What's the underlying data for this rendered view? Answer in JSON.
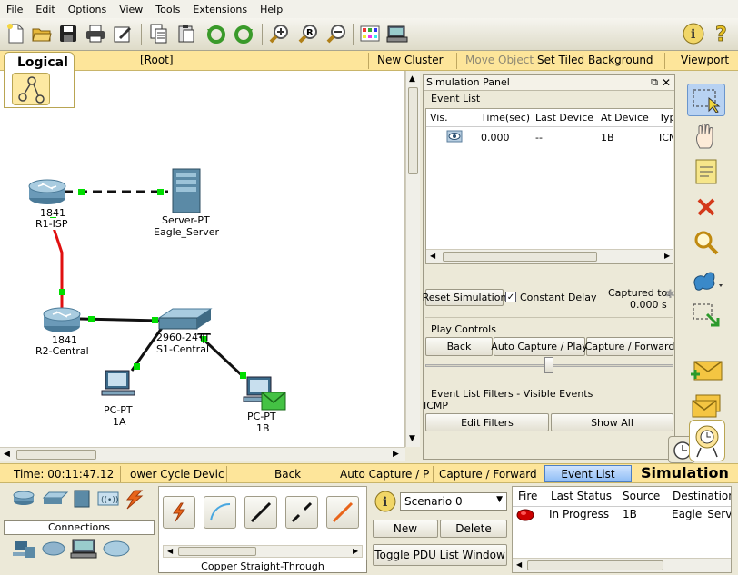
{
  "menu": [
    "File",
    "Edit",
    "Options",
    "View",
    "Tools",
    "Extensions",
    "Help"
  ],
  "toolbar": {
    "icons": [
      "new-file-icon",
      "open-folder-icon",
      "save-icon",
      "print-icon",
      "activity-wizard-icon",
      "copy-icon",
      "paste-icon",
      "undo-icon",
      "redo-icon",
      "zoom-in-icon",
      "zoom-reset-icon",
      "zoom-out-icon",
      "palette-icon",
      "custom-device-icon",
      "info-icon",
      "help-icon"
    ]
  },
  "logical_bar": {
    "tab_label": "Logical",
    "root": "[Root]",
    "new_cluster": "New Cluster",
    "move_object": "Move Object",
    "set_tiled_background": "Set Tiled Background",
    "viewport": "Viewport"
  },
  "topology": {
    "devices": [
      {
        "model": "1841",
        "name": "R1-ISP"
      },
      {
        "model": "Server-PT",
        "name": "Eagle_Server"
      },
      {
        "model": "1841",
        "name": "R2-Central"
      },
      {
        "model": "2960-24TT",
        "name": "S1-Central"
      },
      {
        "model": "PC-PT",
        "name": "1A"
      },
      {
        "model": "PC-PT",
        "name": "1B"
      }
    ],
    "router1_label": "R1-ISP",
    "router1_model": "1841",
    "server_model": "Server-PT",
    "server_name": "Eagle_Server",
    "router2_model": "1841",
    "router2_name": "R2-Central",
    "switch_model": "2960-24TT",
    "switch_name": "S1-Central",
    "pc1_model": "PC-PT",
    "pc1_name": "1A",
    "pc2_model": "PC-PT",
    "pc2_name": "1B",
    "link_up_color": "#00dd00",
    "serial_link_color": "#e01010"
  },
  "sim_panel": {
    "title": "Simulation Panel",
    "event_list_label": "Event List",
    "columns": [
      "Vis.",
      "Time(sec)",
      "Last Device",
      "At Device",
      "Type"
    ],
    "rows": [
      {
        "vis": "eye-icon",
        "time": "0.000",
        "last_device": "--",
        "at_device": "1B",
        "type": "ICMP"
      }
    ],
    "reset_button": "Reset Simulation",
    "constant_delay_label": "Constant Delay",
    "constant_delay_checked": true,
    "captured_to_label": "Captured to:",
    "captured_to_value": "0.000 s",
    "play_controls_label": "Play Controls",
    "back_button": "Back",
    "auto_capture_button": "Auto Capture / Play",
    "capture_forward_button": "Capture / Forward",
    "filters_label": "Event List Filters - Visible Events",
    "filters_value": "ICMP",
    "edit_filters_button": "Edit Filters",
    "show_all_button": "Show All"
  },
  "palette": {
    "icons": [
      "select-icon",
      "move-layout-icon",
      "place-note-icon",
      "delete-icon",
      "inspect-icon",
      "draw-shape-icon",
      "resize-shape-icon",
      "add-simple-pdu-icon",
      "add-complex-pdu-icon"
    ]
  },
  "statusbar": {
    "time": "Time: 00:11:47.12",
    "power_cycle": "ower Cycle Devic",
    "back": "Back",
    "auto_capture": "Auto Capture / P",
    "capture_forward": "Capture / Forward",
    "event_list": "Event List",
    "mode": "Simulation"
  },
  "bottom": {
    "category_label": "Connections",
    "connection_type_label": "Copper Straight-Through",
    "connection_icons": [
      "auto-connection-icon",
      "console-cable-icon",
      "copper-straight-icon",
      "copper-cross-icon",
      "fiber-icon"
    ],
    "scenario": "Scenario 0",
    "new_button": "New",
    "delete_button": "Delete",
    "toggle_pdu_button": "Toggle PDU List Window",
    "pdu_columns": [
      "Fire",
      "Last Status",
      "Source",
      "Destination"
    ],
    "pdu_rows": [
      {
        "fire": "red-dot",
        "status": "In Progress",
        "source": "1B",
        "destination": "Eagle_Server"
      }
    ],
    "pdu_source_label": "1B",
    "pdu_destination_label": "Eagle_Serv"
  }
}
